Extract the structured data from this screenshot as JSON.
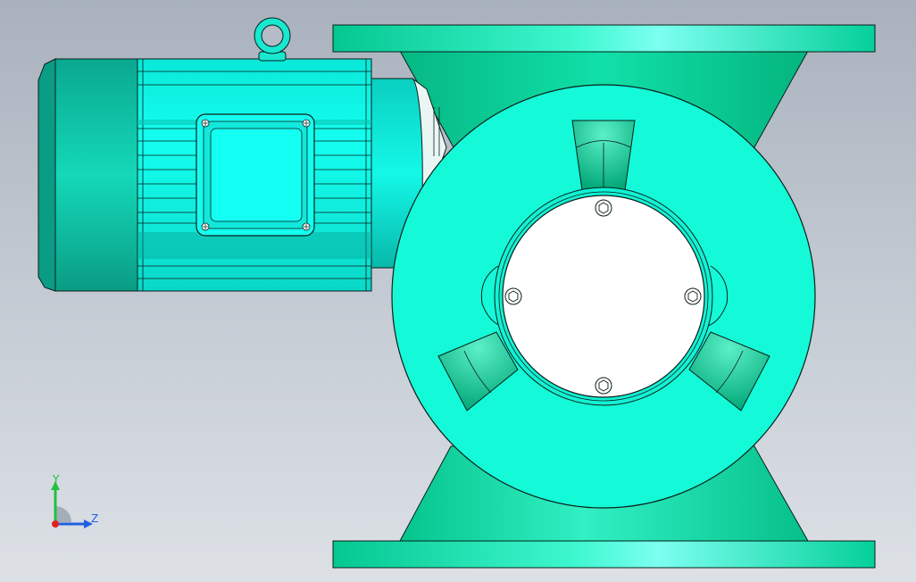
{
  "viewport": {
    "background_top": "#a8b1bd",
    "background_bottom": "#dde1e6"
  },
  "model": {
    "colors": {
      "body_dark": "#04c890",
      "body_mid": "#0ef0b8",
      "body_light": "#5cf8d8",
      "motor_cyan": "#12ffec",
      "motor_dark": "#08b4a8",
      "hub_white": "#ffffff",
      "outline": "#0a1f1a"
    }
  },
  "triad": {
    "y_label": "Y",
    "z_label": "Z",
    "y_color": "#20c040",
    "z_color": "#2060e0",
    "x_color": "#e02020"
  }
}
